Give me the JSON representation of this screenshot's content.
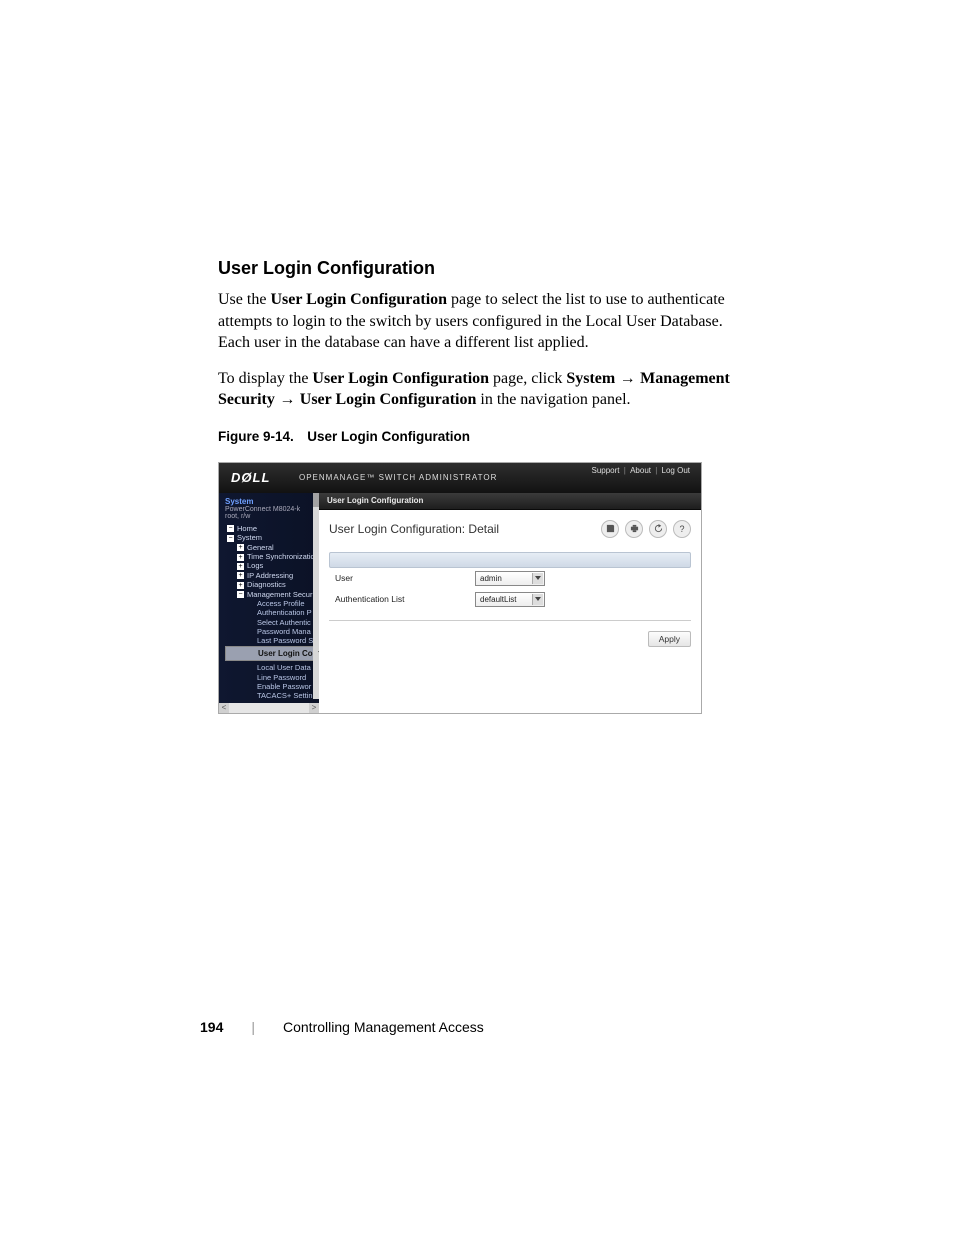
{
  "section_heading": "User Login Configuration",
  "para1_a": "Use the ",
  "para1_b": "User Login Configuration",
  "para1_c": " page to select the list to use to authenticate attempts to login to the switch by users configured in the Local User Database. Each user in the database can have a different list applied.",
  "para2_a": "To display the ",
  "para2_b": "User Login Configuration",
  "para2_c": " page, click ",
  "para2_d": "System",
  "para2_e": " → ",
  "para2_f": "Management Security",
  "para2_g": " → ",
  "para2_h": "User Login Configuration",
  "para2_i": " in the navigation panel.",
  "figure_caption": "Figure 9-14. User Login Configuration",
  "footer": {
    "page": "194",
    "chapter": "Controlling Management Access"
  },
  "shot": {
    "logo": "DØLL",
    "appname": "OPENMANAGE™ SWITCH ADMINISTRATOR",
    "toplinks": {
      "support": "Support",
      "about": "About",
      "logout": "Log Out"
    },
    "sidebar_head": {
      "system": "System",
      "model": "PowerConnect M8024-k",
      "user": "root, r/w"
    },
    "tree": {
      "home": "Home",
      "system": "System",
      "general": "General",
      "time": "Time Synchronization",
      "logs": "Logs",
      "ip": "IP Addressing",
      "diag": "Diagnostics",
      "mgmt": "Management Security",
      "access": "Access Profile",
      "authp": "Authentication P",
      "selauth": "Select Authentic",
      "pwman": "Password Mana",
      "lastpw": "Last Password S",
      "userlogin": "User Login Co",
      "localdb": "Local User Data",
      "linepw": "Line Password",
      "enpw": "Enable Passwor",
      "tacacs": "TACACS+ Settin"
    },
    "crumb": "User Login Configuration",
    "panel_title": "User Login Configuration: Detail",
    "icons": {
      "save": "save-icon",
      "print": "print-icon",
      "refresh": "refresh-icon",
      "help": "help-icon"
    },
    "form": {
      "user_label": "User",
      "user_value": "admin",
      "authlist_label": "Authentication List",
      "authlist_value": "defaultList"
    },
    "apply": "Apply",
    "hsarrows": {
      "left": "<",
      "right": ">"
    }
  }
}
